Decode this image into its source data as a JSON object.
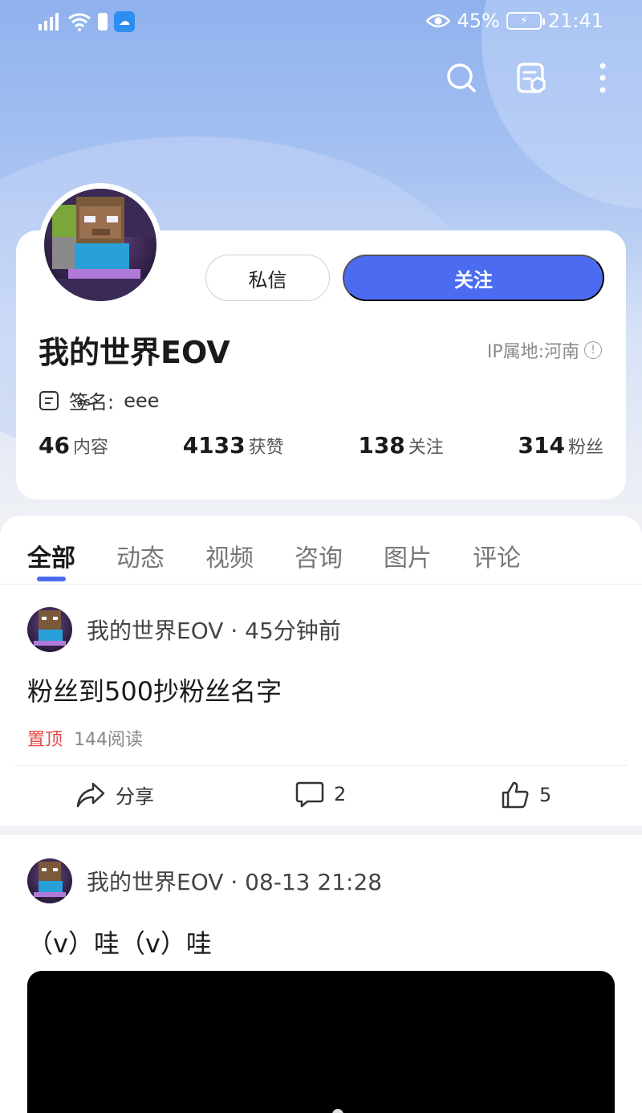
{
  "status_bar": {
    "signal": "4G",
    "battery_percent": "45%",
    "time": "21:41"
  },
  "toolbar": {
    "search_icon": "search-icon",
    "share_card_icon": "profile-card-icon",
    "more_icon": "more-vertical-icon"
  },
  "profile": {
    "message_label": "私信",
    "follow_label": "关注",
    "name": "我的世界EOV",
    "ip_location": "IP属地:河南",
    "signature_label": "签名:",
    "signature_value": "eee",
    "stats": [
      {
        "num": "46",
        "label": "内容"
      },
      {
        "num": "4133",
        "label": "获赞"
      },
      {
        "num": "138",
        "label": "关注"
      },
      {
        "num": "314",
        "label": "粉丝"
      }
    ]
  },
  "tabs": [
    "全部",
    "动态",
    "视频",
    "咨询",
    "图片",
    "评论"
  ],
  "posts": [
    {
      "author": "我的世界EOV",
      "time": "45分钟前",
      "title": "粉丝到500抄粉丝名字",
      "pinned_label": "置顶",
      "reads": "144阅读",
      "share_label": "分享",
      "comments": "2",
      "likes": "5"
    },
    {
      "author": "我的世界EOV",
      "time": "08-13 21:28",
      "title": "（v）哇（v）哇"
    }
  ],
  "colors": {
    "accent": "#4b6cf0",
    "pinned": "#e34a4a"
  }
}
